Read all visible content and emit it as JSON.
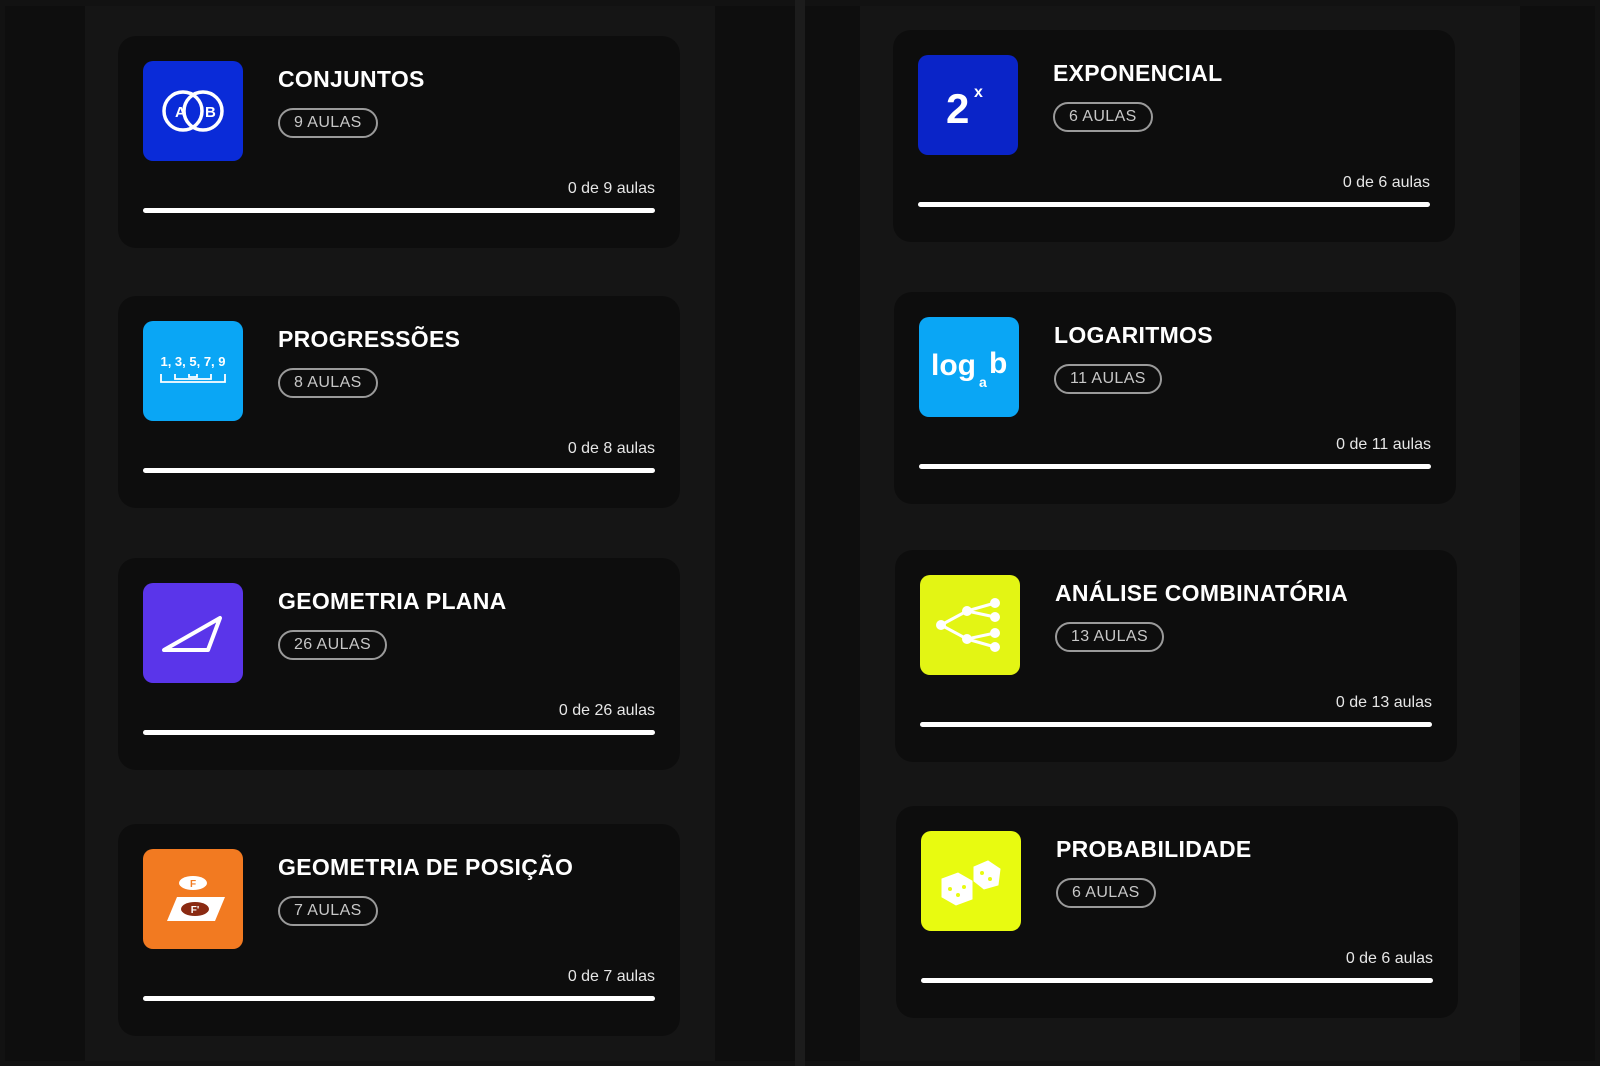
{
  "courses": [
    {
      "title": "CONJUNTOS",
      "lessons_badge": "9 AULAS",
      "progress_text": "0 de 9 aulas",
      "progress_completed": 0,
      "progress_total": 9,
      "icon": "venn-diagram-icon",
      "icon_color": "#0a2bd8",
      "icon_text_a": "A",
      "icon_text_b": "B"
    },
    {
      "title": "PROGRESSÕES",
      "lessons_badge": "8 AULAS",
      "progress_text": "0 de 8 aulas",
      "progress_completed": 0,
      "progress_total": 8,
      "icon": "sequence-icon",
      "icon_color": "#0aa6f5",
      "icon_text": "1, 3, 5, 7, 9"
    },
    {
      "title": "GEOMETRIA PLANA",
      "lessons_badge": "26 AULAS",
      "progress_text": "0 de 26 aulas",
      "progress_completed": 0,
      "progress_total": 26,
      "icon": "triangle-icon",
      "icon_color": "#5a35ea"
    },
    {
      "title": "GEOMETRIA DE POSIÇÃO",
      "lessons_badge": "7 AULAS",
      "progress_text": "0 de 7 aulas",
      "progress_completed": 0,
      "progress_total": 7,
      "icon": "plane-projection-icon",
      "icon_color": "#f27a21",
      "icon_text_top": "F",
      "icon_text_bottom": "F'"
    },
    {
      "title": "EXPONENCIAL",
      "lessons_badge": "6 AULAS",
      "progress_text": "0 de 6 aulas",
      "progress_completed": 0,
      "progress_total": 6,
      "icon": "exponent-icon",
      "icon_color": "#0a24c8",
      "icon_text_base": "2",
      "icon_text_exp": "x"
    },
    {
      "title": "LOGARITMOS",
      "lessons_badge": "11 AULAS",
      "progress_text": "0 de 11 aulas",
      "progress_completed": 0,
      "progress_total": 11,
      "icon": "logarithm-icon",
      "icon_color": "#0aa6f5",
      "icon_text_log": "log",
      "icon_text_sub": "a",
      "icon_text_b": "b"
    },
    {
      "title": "ANÁLISE COMBINATÓRIA",
      "lessons_badge": "13 AULAS",
      "progress_text": "0 de 13 aulas",
      "progress_completed": 0,
      "progress_total": 13,
      "icon": "branching-tree-icon",
      "icon_color": "#e3f514"
    },
    {
      "title": "PROBABILIDADE",
      "lessons_badge": "6 AULAS",
      "progress_text": "0 de 6 aulas",
      "progress_completed": 0,
      "progress_total": 6,
      "icon": "dice-icon",
      "icon_color": "#e8fb10"
    }
  ]
}
